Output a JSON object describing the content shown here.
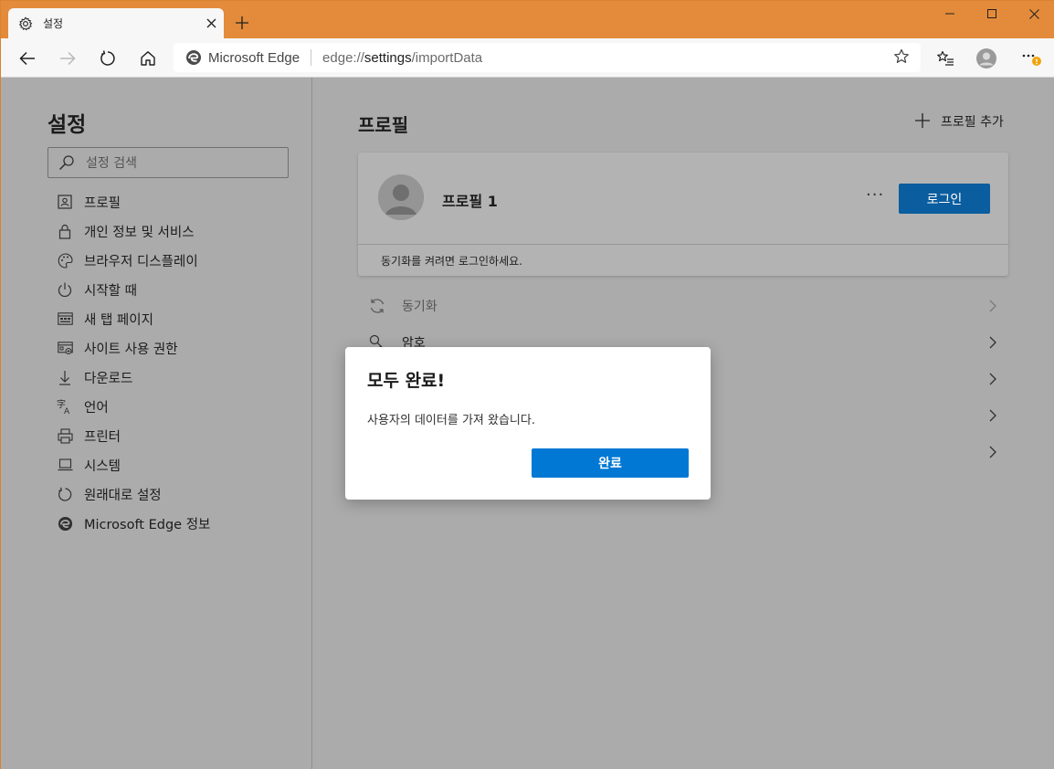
{
  "tab": {
    "title": "설정",
    "icon": "gear-icon"
  },
  "window_controls": {
    "minimize": "minimize-icon",
    "maximize": "maximize-icon",
    "close": "close-icon"
  },
  "address": {
    "site_label": "Microsoft Edge",
    "url_prefix": "edge://",
    "url_main": "settings",
    "url_suffix": "/importData"
  },
  "sidebar": {
    "title": "설정",
    "search_placeholder": "설정 검색",
    "items": [
      {
        "label": "프로필",
        "icon": "profile-icon"
      },
      {
        "label": "개인 정보 및 서비스",
        "icon": "lock-icon"
      },
      {
        "label": "브라우저 디스플레이",
        "icon": "palette-icon"
      },
      {
        "label": "시작할 때",
        "icon": "power-icon"
      },
      {
        "label": "새 탭 페이지",
        "icon": "new-tab-page-icon"
      },
      {
        "label": "사이트 사용 권한",
        "icon": "site-permissions-icon"
      },
      {
        "label": "다운로드",
        "icon": "download-icon"
      },
      {
        "label": "언어",
        "icon": "language-icon"
      },
      {
        "label": "프린터",
        "icon": "printer-icon"
      },
      {
        "label": "시스템",
        "icon": "laptop-icon"
      },
      {
        "label": "원래대로 설정",
        "icon": "reset-icon"
      },
      {
        "label": "Microsoft Edge 정보",
        "icon": "edge-icon"
      }
    ]
  },
  "main": {
    "title": "프로필",
    "add_profile_label": "프로필 추가",
    "profile_name": "프로필 1",
    "login_label": "로그인",
    "sync_prompt": "동기화를 켜려면 로그인하세요.",
    "more_label": "···",
    "rows": [
      {
        "label": "동기화",
        "icon": "sync-icon"
      },
      {
        "label": "암호",
        "icon": "key-icon"
      },
      {
        "label": "",
        "icon": ""
      },
      {
        "label": "",
        "icon": ""
      },
      {
        "label": "",
        "icon": ""
      }
    ]
  },
  "dialog": {
    "title": "모두 완료!",
    "message": "사용자의 데이터를 가져 왔습니다.",
    "button_label": "완료"
  },
  "colors": {
    "titlebar": "#e38b3a",
    "accent": "#0078d4",
    "overlay": "#ababab",
    "notification_badge": "#f0a30a"
  }
}
